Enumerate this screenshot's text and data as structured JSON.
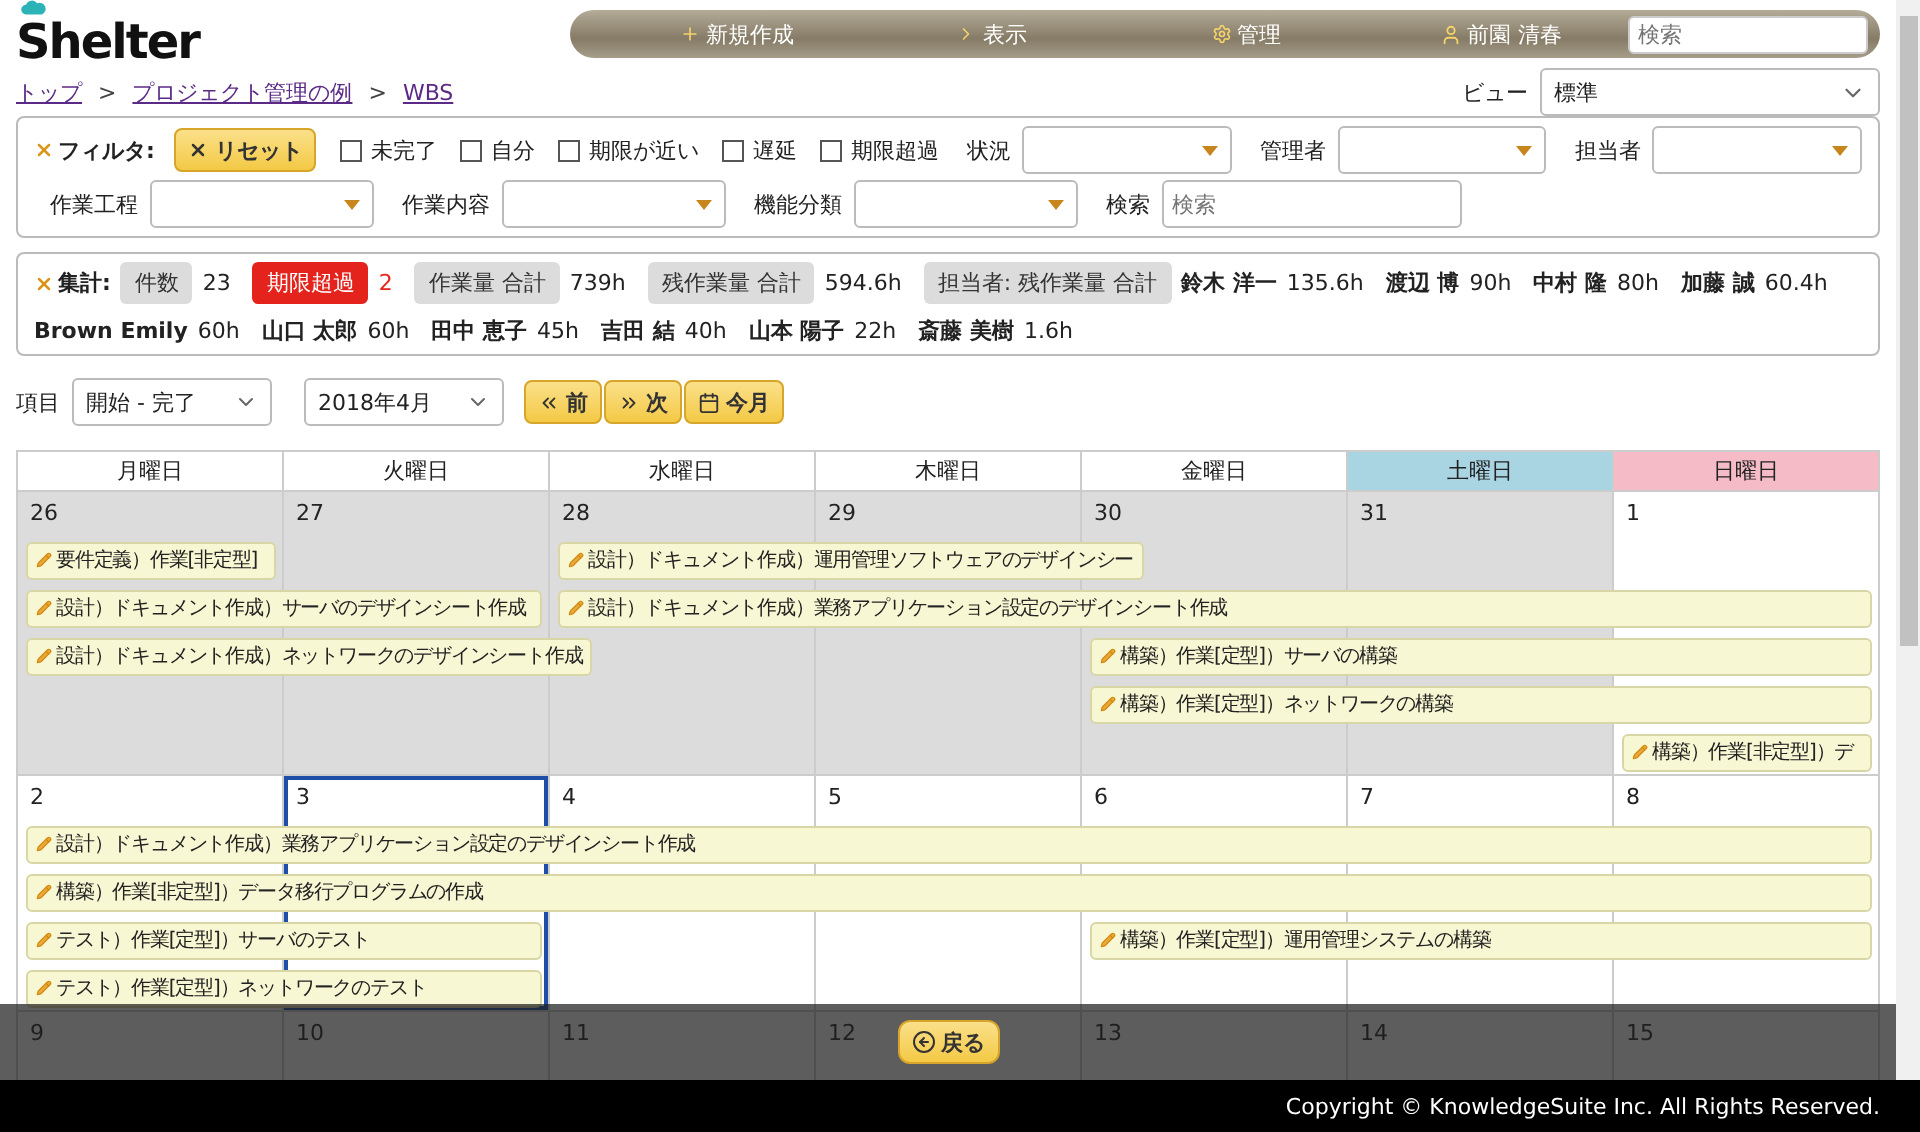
{
  "logo": "Shelter",
  "nav": {
    "items": [
      {
        "kind": "plus",
        "label": "新規作成"
      },
      {
        "kind": "arrow",
        "label": "表示"
      },
      {
        "kind": "gear",
        "label": "管理"
      },
      {
        "kind": "user",
        "label": "前園 清春"
      }
    ],
    "search_placeholder": "検索"
  },
  "breadcrumb": [
    {
      "kind": "link",
      "text": "トップ"
    },
    {
      "kind": "separator",
      "text": ">"
    },
    {
      "kind": "link",
      "text": "プロジェクト管理の例"
    },
    {
      "kind": "separator",
      "text": ">"
    },
    {
      "kind": "link",
      "text": "WBS"
    }
  ],
  "view": {
    "label": "ビュー",
    "value": "標準"
  },
  "filter": {
    "title": "フィルタ:",
    "reset": "リセット",
    "checkboxes": [
      {
        "label": "未完了",
        "checked": false
      },
      {
        "label": "自分",
        "checked": false
      },
      {
        "label": "期限が近い",
        "checked": false
      },
      {
        "label": "遅延",
        "checked": false
      },
      {
        "label": "期限超過",
        "checked": false
      }
    ],
    "row1_selects": [
      {
        "label": "状況"
      },
      {
        "label": "管理者"
      },
      {
        "label": "担当者"
      }
    ],
    "row2_selects": [
      {
        "label": "作業工程"
      },
      {
        "label": "作業内容"
      },
      {
        "label": "機能分類"
      }
    ],
    "search": {
      "label": "検索",
      "placeholder": "検索"
    }
  },
  "summary": {
    "title": "集計:",
    "items": [
      {
        "kind": "chip",
        "label": "件数",
        "value": "23"
      },
      {
        "kind": "alert",
        "label": "期限超過",
        "value": "2"
      },
      {
        "kind": "chip",
        "label": "作業量 合計",
        "value": "739h"
      },
      {
        "kind": "chip",
        "label": "残作業量 合計",
        "value": "594.6h"
      },
      {
        "kind": "chip",
        "label": "担当者: 残作業量 合計"
      },
      {
        "kind": "person",
        "label": "鈴木 洋一",
        "value": "135.6h"
      },
      {
        "kind": "person",
        "label": "渡辺 博",
        "value": "90h"
      },
      {
        "kind": "person",
        "label": "中村 隆",
        "value": "80h"
      },
      {
        "kind": "person",
        "label": "加藤 誠",
        "value": "60.4h"
      },
      {
        "kind": "person",
        "label": "Brown Emily",
        "value": "60h"
      },
      {
        "kind": "person",
        "label": "山口 太郎",
        "value": "60h"
      },
      {
        "kind": "person",
        "label": "田中 恵子",
        "value": "45h"
      },
      {
        "kind": "person",
        "label": "吉田 結",
        "value": "40h"
      },
      {
        "kind": "person",
        "label": "山本 陽子",
        "value": "22h"
      },
      {
        "kind": "person",
        "label": "斎藤 美樹",
        "value": "1.6h"
      }
    ]
  },
  "controls": {
    "label": "項目",
    "range": "開始 - 完了",
    "month": "2018年4月",
    "buttons": [
      {
        "kind": "prev",
        "label": "前"
      },
      {
        "kind": "next",
        "label": "次"
      },
      {
        "kind": "today",
        "label": "今月"
      }
    ]
  },
  "calendar": {
    "weekdays": [
      {
        "kind": "weekday",
        "label": "月曜日"
      },
      {
        "kind": "weekday",
        "label": "火曜日"
      },
      {
        "kind": "weekday",
        "label": "水曜日"
      },
      {
        "kind": "weekday",
        "label": "木曜日"
      },
      {
        "kind": "weekday",
        "label": "金曜日"
      },
      {
        "kind": "saturday",
        "label": "土曜日"
      },
      {
        "kind": "sunday",
        "label": "日曜日"
      }
    ],
    "weeks": [
      {
        "days": [
          {
            "date": "26",
            "outside": true,
            "today": false
          },
          {
            "date": "27",
            "outside": true,
            "today": false
          },
          {
            "date": "28",
            "outside": true,
            "today": false
          },
          {
            "date": "29",
            "outside": true,
            "today": false
          },
          {
            "date": "30",
            "outside": true,
            "today": false
          },
          {
            "date": "31",
            "outside": true,
            "today": false
          },
          {
            "date": "1",
            "outside": false,
            "today": false
          }
        ],
        "lanes": [
          [
            {
              "kind": "event",
              "title": "要件定義）作業[非定型]"
            },
            {
              "kind": "empty"
            },
            {
              "kind": "event",
              "title": "設計）ドキュメント作成）運用管理ソフトウェアのデザインシー"
            },
            {
              "kind": "continue"
            },
            {
              "kind": "empty"
            },
            {
              "kind": "empty"
            },
            {
              "kind": "empty"
            }
          ],
          [
            {
              "kind": "event",
              "title": "設計）ドキュメント作成）サーバのデザインシート作成"
            },
            {
              "kind": "continue"
            },
            {
              "kind": "event",
              "title": "設計）ドキュメント作成）業務アプリケーション設定のデザインシート作成"
            },
            {
              "kind": "continue"
            },
            {
              "kind": "continue"
            },
            {
              "kind": "continue"
            },
            {
              "kind": "continue"
            }
          ],
          [
            {
              "kind": "event",
              "title": "設計）ドキュメント作成）ネットワークのデザインシート作成"
            },
            {
              "kind": "continue"
            },
            {
              "kind": "empty"
            },
            {
              "kind": "empty"
            },
            {
              "kind": "event",
              "title": "構築）作業[定型]）サーバの構築"
            },
            {
              "kind": "continue"
            },
            {
              "kind": "continue"
            }
          ],
          [
            {
              "kind": "empty"
            },
            {
              "kind": "empty"
            },
            {
              "kind": "empty"
            },
            {
              "kind": "empty"
            },
            {
              "kind": "event",
              "title": "構築）作業[定型]）ネットワークの構築"
            },
            {
              "kind": "continue"
            },
            {
              "kind": "continue"
            }
          ],
          [
            {
              "kind": "empty"
            },
            {
              "kind": "empty"
            },
            {
              "kind": "empty"
            },
            {
              "kind": "empty"
            },
            {
              "kind": "empty"
            },
            {
              "kind": "empty"
            },
            {
              "kind": "event",
              "title": "構築）作業[非定型]）デ"
            }
          ]
        ]
      },
      {
        "days": [
          {
            "date": "2",
            "outside": false,
            "today": false
          },
          {
            "date": "3",
            "outside": false,
            "today": true
          },
          {
            "date": "4",
            "outside": false,
            "today": false
          },
          {
            "date": "5",
            "outside": false,
            "today": false
          },
          {
            "date": "6",
            "outside": false,
            "today": false
          },
          {
            "date": "7",
            "outside": false,
            "today": false
          },
          {
            "date": "8",
            "outside": false,
            "today": false
          }
        ],
        "lanes": [
          [
            {
              "kind": "event",
              "title": "設計）ドキュメント作成）業務アプリケーション設定のデザインシート作成"
            },
            {
              "kind": "continue"
            },
            {
              "kind": "continue"
            },
            {
              "kind": "continue"
            },
            {
              "kind": "continue"
            },
            {
              "kind": "continue"
            },
            {
              "kind": "continue"
            }
          ],
          [
            {
              "kind": "event",
              "title": "構築）作業[非定型]）データ移行プログラムの作成"
            },
            {
              "kind": "continue"
            },
            {
              "kind": "continue"
            },
            {
              "kind": "continue"
            },
            {
              "kind": "continue"
            },
            {
              "kind": "continue"
            },
            {
              "kind": "continue"
            }
          ],
          [
            {
              "kind": "event",
              "title": "テスト）作業[定型]）サーバのテスト"
            },
            {
              "kind": "continue"
            },
            {
              "kind": "empty"
            },
            {
              "kind": "empty"
            },
            {
              "kind": "event",
              "title": "構築）作業[定型]）運用管理システムの構築"
            },
            {
              "kind": "continue"
            },
            {
              "kind": "continue"
            }
          ],
          [
            {
              "kind": "event",
              "title": "テスト）作業[定型]）ネットワークのテスト"
            },
            {
              "kind": "continue"
            },
            {
              "kind": "empty"
            },
            {
              "kind": "empty"
            },
            {
              "kind": "empty"
            },
            {
              "kind": "empty"
            },
            {
              "kind": "empty"
            }
          ]
        ]
      },
      {
        "days": [
          {
            "date": "9",
            "today": false
          },
          {
            "date": "10",
            "today": false
          },
          {
            "date": "11",
            "today": false
          },
          {
            "date": "12",
            "today": false
          },
          {
            "date": "13",
            "today": false
          },
          {
            "date": "14",
            "today": false
          },
          {
            "date": "15",
            "today": false
          }
        ]
      }
    ]
  },
  "back_button": "戻る",
  "footer": "Copyright © KnowledgeSuite Inc. All Rights Reserved."
}
